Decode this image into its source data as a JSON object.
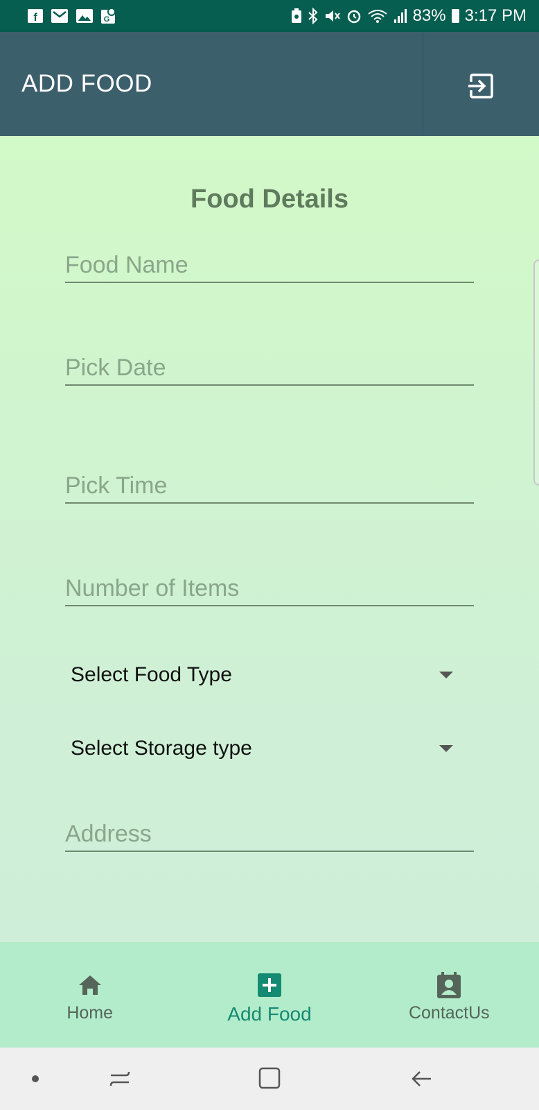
{
  "status_bar": {
    "battery": "83%",
    "time": "3:17 PM",
    "left_icons": [
      "facebook-icon",
      "gmail-icon",
      "gallery-icon",
      "maps-icon"
    ],
    "right_icons": [
      "battery-saver-icon",
      "bluetooth-icon",
      "mute-icon",
      "alarm-icon",
      "wifi-icon",
      "signal-icon"
    ]
  },
  "app_bar": {
    "title": "ADD FOOD",
    "action_icon": "logout-icon",
    "color": "#3c5f6c"
  },
  "form": {
    "title": "Food Details",
    "food_name": {
      "placeholder": "Food Name",
      "value": ""
    },
    "pick_date": {
      "placeholder": "Pick Date",
      "value": ""
    },
    "pick_time": {
      "placeholder": "Pick Time",
      "value": ""
    },
    "item_count": {
      "placeholder": "Number of Items",
      "value": ""
    },
    "food_type": {
      "selected": "Select Food Type"
    },
    "storage_type": {
      "selected": "Select Storage type"
    },
    "address": {
      "placeholder": "Address",
      "value": ""
    }
  },
  "bottom_nav": {
    "items": [
      {
        "label": "Home",
        "icon": "home-icon"
      },
      {
        "label": "Add Food",
        "icon": "add-box-icon"
      },
      {
        "label": "ContactUs",
        "icon": "contact-icon"
      }
    ],
    "active_index": 1,
    "active_color": "#148a72"
  },
  "system_nav": {
    "icons": [
      "dot-icon",
      "recents-icon",
      "home-square-icon",
      "back-icon"
    ]
  }
}
